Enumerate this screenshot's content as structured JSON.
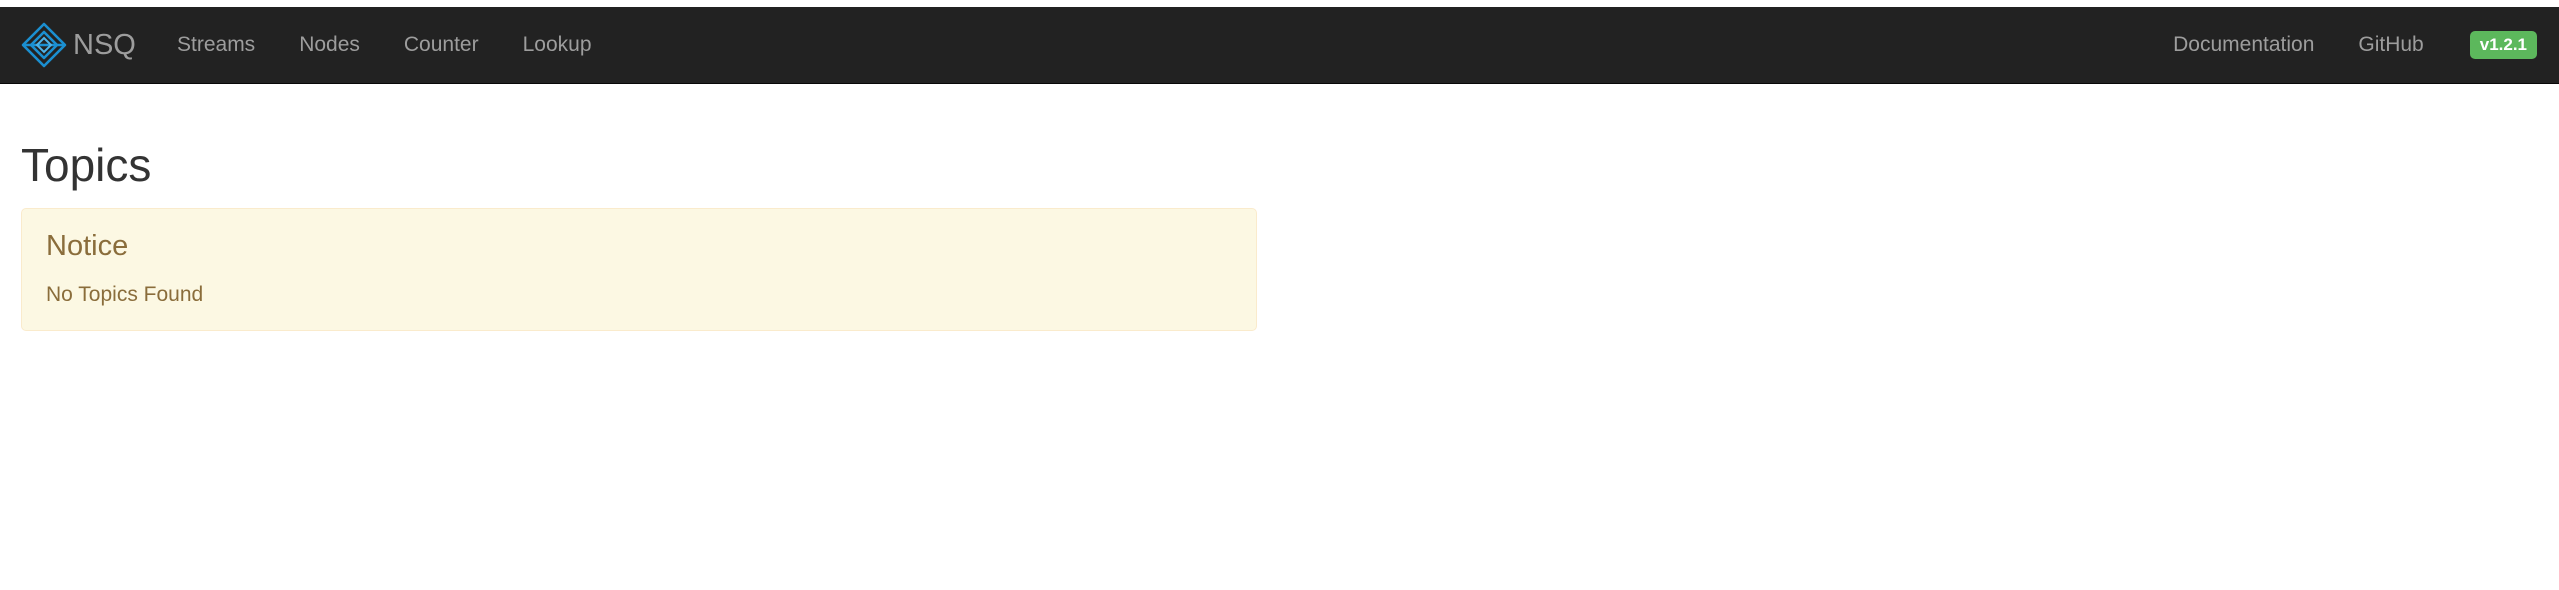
{
  "navbar": {
    "brand": {
      "icon": "nsq-logo-icon",
      "label": "NSQ"
    },
    "left_links": [
      {
        "label": "Streams"
      },
      {
        "label": "Nodes"
      },
      {
        "label": "Counter"
      },
      {
        "label": "Lookup"
      }
    ],
    "right_links": [
      {
        "label": "Documentation"
      },
      {
        "label": "GitHub"
      }
    ],
    "version": "v1.2.1"
  },
  "main": {
    "title": "Topics",
    "notice": {
      "heading": "Notice",
      "message": "No Topics Found"
    }
  },
  "colors": {
    "navbar_bg": "#222222",
    "nav_text": "#9d9d9d",
    "logo_blue": "#1b8fd1",
    "badge_green": "#5cb85c",
    "notice_bg": "#fcf8e3",
    "notice_border": "#faebcc",
    "notice_text": "#8a6d3b"
  }
}
